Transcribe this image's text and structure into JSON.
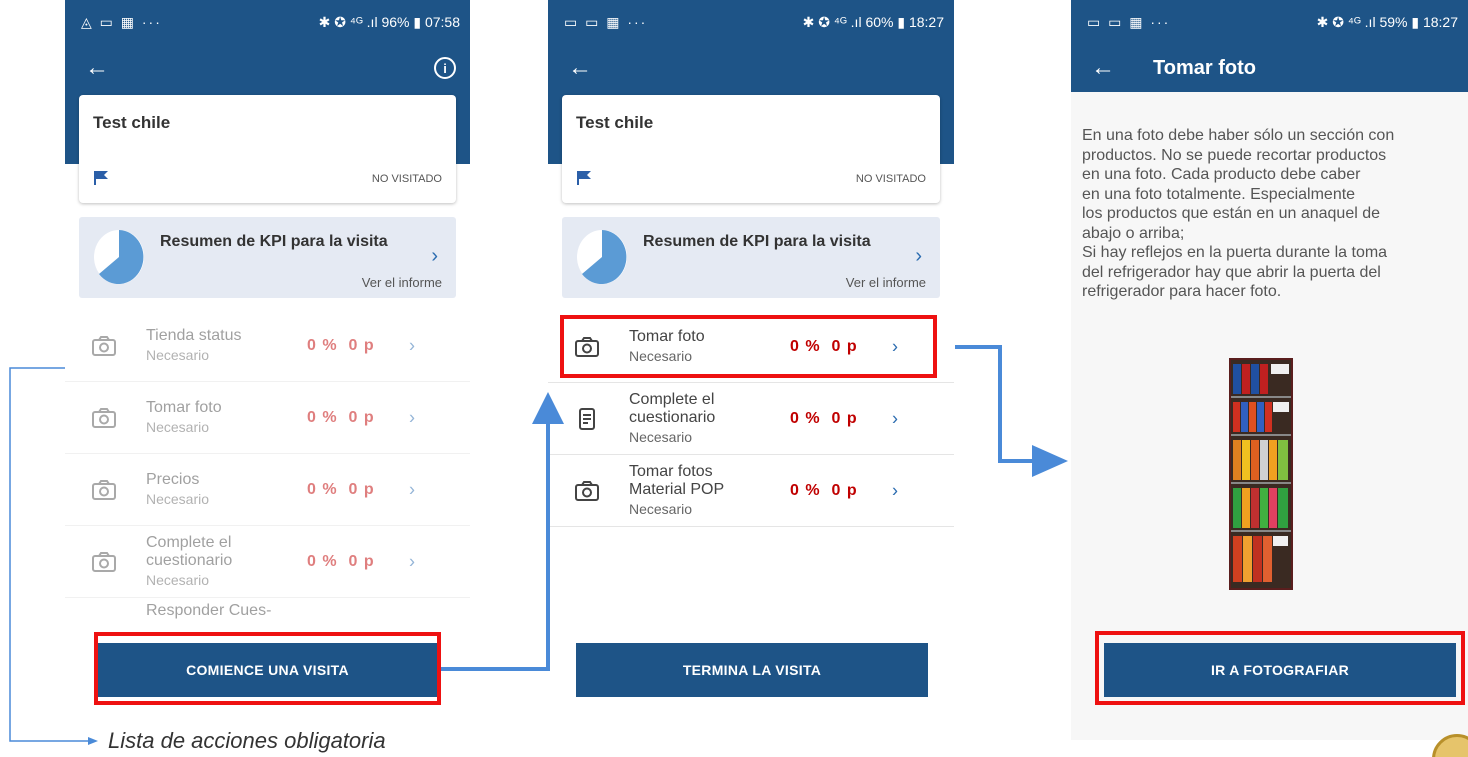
{
  "colors": {
    "primary": "#1e5487",
    "accent_red": "#c00000",
    "highlight_box": "#ee1111",
    "arrow_blue": "#4a8ad8"
  },
  "phone1": {
    "statusbar": {
      "left": "◬ ▭ ▦ ···",
      "right": "✱ ✪ ⁴ᴳ .ıl 96% ▮ 07:58"
    },
    "card": {
      "name": "Test chile",
      "status": "NO VISITADO"
    },
    "kpi": {
      "label": "Resumen de KPI para la visita",
      "link": "Ver el informe",
      "progress": 0.6
    },
    "rows": [
      {
        "title": "Tienda status",
        "subtitle": "Necesario",
        "pct": "0 %",
        "points": "0 p",
        "icon": "camera-icon"
      },
      {
        "title": "Tomar foto",
        "subtitle": "Necesario",
        "pct": "0 %",
        "points": "0 p",
        "icon": "camera-icon"
      },
      {
        "title": "Precios",
        "subtitle": "Necesario",
        "pct": "0 %",
        "points": "0 p",
        "icon": "camera-icon"
      },
      {
        "title_l1": "Complete el",
        "title_l2": "cuestionario",
        "subtitle": "Necesario",
        "pct": "0 %",
        "points": "0 p",
        "icon": "camera-icon"
      },
      {
        "title": "Responder Cues-"
      }
    ],
    "button": "COMIENCE UNA VISITA"
  },
  "phone2": {
    "statusbar": {
      "left": "▭ ▭ ▦ ···",
      "right": "✱ ✪ ⁴ᴳ .ıl 60% ▮ 18:27"
    },
    "card": {
      "name": "Test chile",
      "status": "NO VISITADO"
    },
    "kpi": {
      "label": "Resumen de KPI para la visita",
      "link": "Ver el informe",
      "progress": 0.6
    },
    "rows": [
      {
        "title": "Tomar foto",
        "subtitle": "Necesario",
        "pct": "0 %",
        "points": "0 p",
        "icon": "camera-icon"
      },
      {
        "title_l1": "Complete el",
        "title_l2": "cuestionario",
        "subtitle": "Necesario",
        "pct": "0 %",
        "points": "0 p",
        "icon": "document-icon"
      },
      {
        "title_l1": "Tomar fotos",
        "title_l2": "Material POP",
        "subtitle": "Necesario",
        "pct": "0 %",
        "points": "0 p",
        "icon": "camera-icon"
      }
    ],
    "button": "TERMINA LA VISITA"
  },
  "phone3": {
    "statusbar": {
      "left": "▭ ▭ ▦ ···",
      "right": "✱ ✪ ⁴ᴳ .ıl 59% ▮ 18:27"
    },
    "title": "Tomar foto",
    "help_lines": [
      "En una foto debe haber sólo un sección con",
      "productos. No se puede recortar productos",
      "en una foto. Cada producto debe caber",
      "en una foto totalmente. Especialmente",
      "los productos que están en un anaquel de",
      "abajo o arriba;",
      "Si hay reflejos en la puerta durante la toma",
      "del refrigerador hay que abrir la puerta del",
      "refrigerador para hacer foto."
    ],
    "button": "IR A FOTOGRAFIAR"
  },
  "caption": "Lista de acciones obligatoria"
}
